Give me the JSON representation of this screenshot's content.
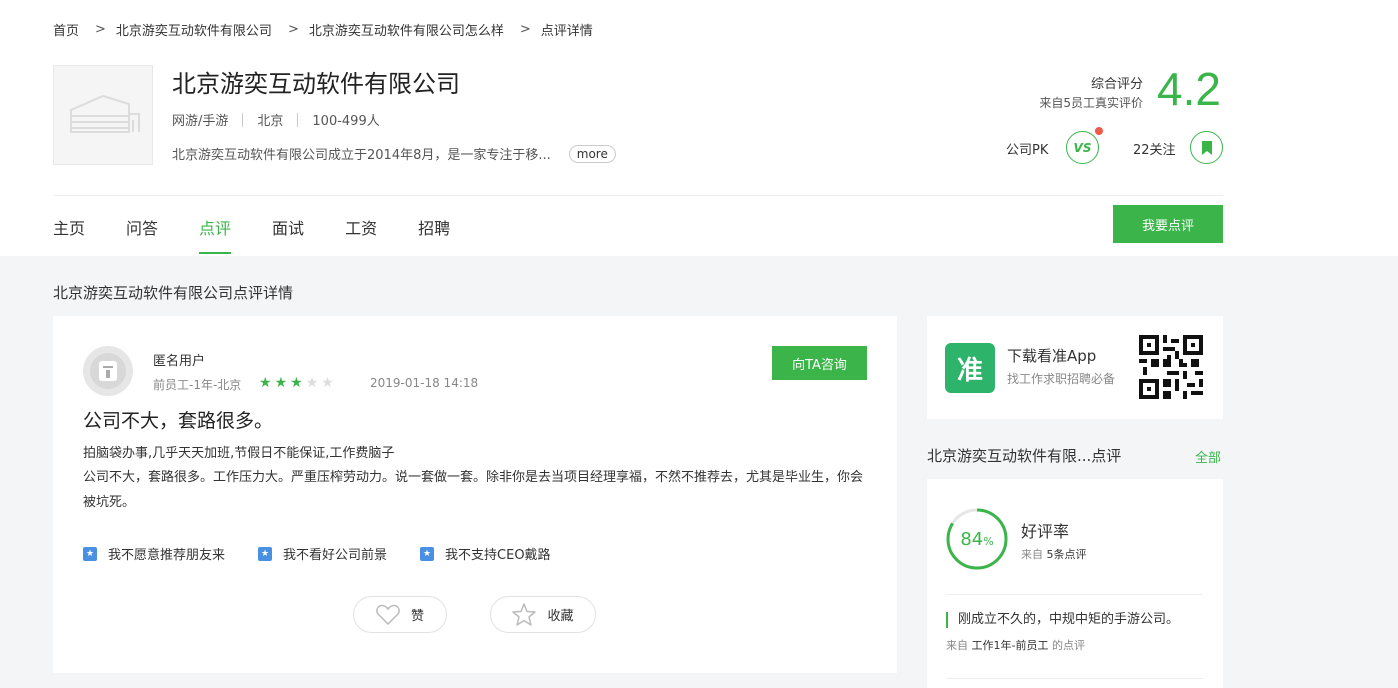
{
  "breadcrumb": {
    "items": [
      "首页",
      "北京游奕互动软件有限公司",
      "北京游奕互动软件有限公司怎么样",
      "点评详情"
    ],
    "separator": ">"
  },
  "company": {
    "name": "北京游奕互动软件有限公司",
    "industry": "网游/手游",
    "city": "北京",
    "size": "100-499人",
    "description": "北京游奕互动软件有限公司成立于2014年8月，是一家专注于移...",
    "more_label": "more"
  },
  "score": {
    "label": "综合评分",
    "source": "来自5员工真实评价",
    "value": "4.2"
  },
  "actions": {
    "pk_label": "公司PK",
    "vs_text": "VS",
    "follow_label": "22关注"
  },
  "nav": {
    "tabs": [
      "主页",
      "问答",
      "点评",
      "面试",
      "工资",
      "招聘"
    ],
    "active_index": 2,
    "write_review_label": "我要点评"
  },
  "section_title": "北京游奕互动软件有限公司点评详情",
  "review": {
    "username": "匿名用户",
    "user_info": "前员工-1年-北京",
    "rating": 3,
    "rating_max": 5,
    "date": "2019-01-18 14:18",
    "consult_label": "向TA咨询",
    "title": "公司不大，套路很多。",
    "tags": "拍脑袋办事,几乎天天加班,节假日不能保证,工作费脑子",
    "body": "公司不大，套路很多。工作压力大。严重压榨劳动力。说一套做一套。除非你是去当项目经理享福，不然不推荐去，尤其是毕业生，你会被坑死。",
    "opinions": [
      "我不愿意推荐朋友来",
      "我不看好公司前景",
      "我不支持CEO戴路"
    ],
    "like_label": "赞",
    "favorite_label": "收藏"
  },
  "app_promo": {
    "logo_text": "准",
    "title": "下载看准App",
    "subtitle": "找工作求职招聘必备"
  },
  "side_reviews": {
    "title": "北京游奕互动软件有限...点评",
    "all_label": "全部",
    "good_rate": 84,
    "good_rate_unit": "%",
    "good_rate_label": "好评率",
    "source_prefix": "来自",
    "source_count": "5条点评",
    "quote": "刚成立不久的，中规中矩的手游公司。",
    "quote_from_prefix": "来自",
    "quote_from_detail": "工作1年-前员工",
    "quote_from_suffix": "的点评"
  },
  "colors": {
    "accent": "#3bb54a",
    "opinion_icon": "#4a90e2",
    "background_gray": "#f4f5f7"
  }
}
